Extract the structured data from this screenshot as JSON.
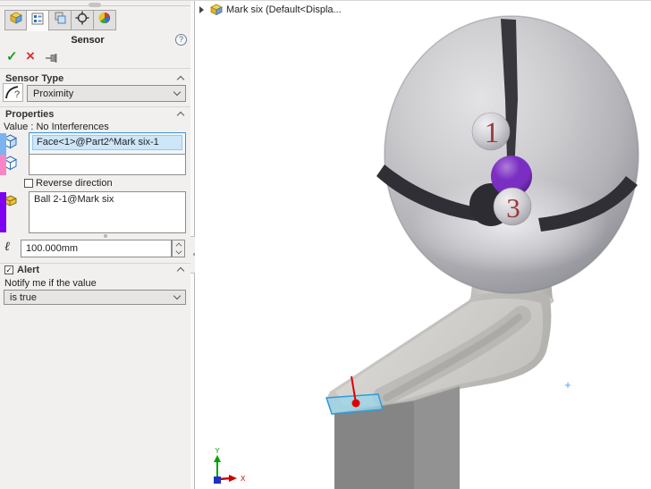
{
  "panel": {
    "title": "Sensor",
    "help": "?",
    "tabs": [
      {
        "name": "featuremanager-tab"
      },
      {
        "name": "propertymanager-tab",
        "active": true
      },
      {
        "name": "configurationmanager-tab"
      },
      {
        "name": "dimxpertmanager-tab"
      },
      {
        "name": "displaymanager-tab"
      }
    ],
    "toolbar": {
      "ok": "✓",
      "cancel": "×"
    },
    "sensor_type": {
      "label": "Sensor Type",
      "value": "Proximity"
    },
    "properties": {
      "label": "Properties",
      "value_line": "Value : No Interferences",
      "face_selection": "Face<1>@Part2^Mark six-1",
      "reverse_label": "Reverse direction",
      "component_selection": "Ball 2-1@Mark six",
      "distance": "100.000mm"
    },
    "alert": {
      "label": "Alert",
      "notify_line": "Notify me if the value",
      "condition": "is true"
    }
  },
  "viewport": {
    "tree_node": "Mark six  (Default<Displa...",
    "ball_front_label": "1",
    "ball_mid_label": "3",
    "triad": {
      "x": "X",
      "y": "Y"
    },
    "pointer_mark": "+"
  },
  "colors": {
    "accent_blue": "#3f93d2",
    "selection_stripe_blue": "#7ab3f0",
    "selection_stripe_pink": "#f786c5",
    "selection_stripe_purple": "#7d00f0",
    "face_highlight": "#98d6ea",
    "face_highlight_border": "#2e9ad8",
    "marker_red": "#e00000",
    "ball_number_red": "#9c3838",
    "purple_ball": "#7b2fc2",
    "ok_green": "#1f9f1f",
    "cancel_red": "#d93030"
  }
}
